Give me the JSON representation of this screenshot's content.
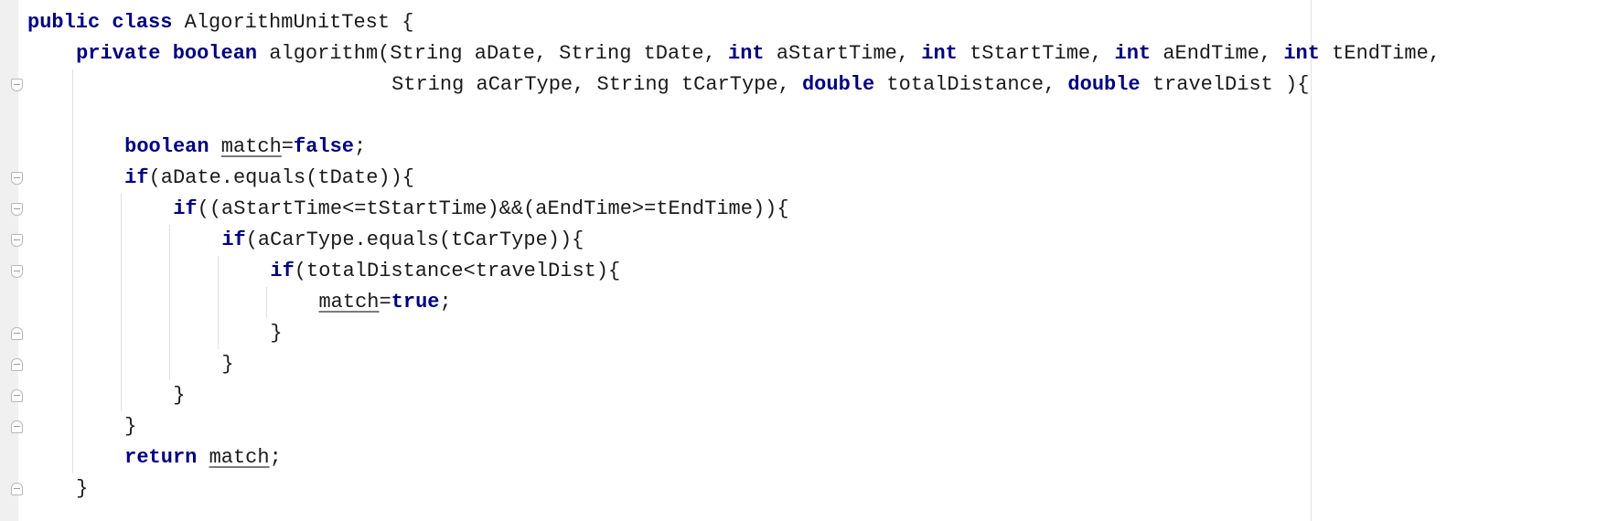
{
  "editor": {
    "language": "java",
    "colors": {
      "keyword": "#000080",
      "text": "#1a1a1a",
      "gutter": "#f0f0f0",
      "indent_guide": "#e0e0e0"
    },
    "lines": [
      {
        "indent": 0,
        "tokens": [
          {
            "text": "public",
            "kind": "kw"
          },
          {
            "text": " "
          },
          {
            "text": "class",
            "kind": "kw"
          },
          {
            "text": " AlgorithmUnitTest {"
          }
        ]
      },
      {
        "indent": 4,
        "tokens": [
          {
            "text": "private",
            "kind": "kw"
          },
          {
            "text": " "
          },
          {
            "text": "boolean",
            "kind": "kw"
          },
          {
            "text": " algorithm(String aDate, String tDate, "
          },
          {
            "text": "int",
            "kind": "kw"
          },
          {
            "text": " aStartTime, "
          },
          {
            "text": "int",
            "kind": "kw"
          },
          {
            "text": " tStartTime, "
          },
          {
            "text": "int",
            "kind": "kw"
          },
          {
            "text": " aEndTime, "
          },
          {
            "text": "int",
            "kind": "kw"
          },
          {
            "text": " tEndTime,"
          }
        ]
      },
      {
        "indent": 30,
        "tokens": [
          {
            "text": "String aCarType, String tCarType, "
          },
          {
            "text": "double",
            "kind": "kw"
          },
          {
            "text": " totalDistance, "
          },
          {
            "text": "double",
            "kind": "kw"
          },
          {
            "text": " travelDist ){"
          }
        ]
      },
      {
        "indent": 0,
        "tokens": []
      },
      {
        "indent": 8,
        "tokens": [
          {
            "text": "boolean",
            "kind": "kw"
          },
          {
            "text": " "
          },
          {
            "text": "match",
            "kind": "var"
          },
          {
            "text": "="
          },
          {
            "text": "false",
            "kind": "kw"
          },
          {
            "text": ";"
          }
        ]
      },
      {
        "indent": 8,
        "tokens": [
          {
            "text": "if",
            "kind": "kw"
          },
          {
            "text": "(aDate.equals(tDate)){"
          }
        ]
      },
      {
        "indent": 12,
        "tokens": [
          {
            "text": "if",
            "kind": "kw"
          },
          {
            "text": "((aStartTime<=tStartTime)&&(aEndTime>=tEndTime)){"
          }
        ]
      },
      {
        "indent": 16,
        "tokens": [
          {
            "text": "if",
            "kind": "kw"
          },
          {
            "text": "(aCarType.equals(tCarType)){"
          }
        ]
      },
      {
        "indent": 20,
        "tokens": [
          {
            "text": "if",
            "kind": "kw"
          },
          {
            "text": "(totalDistance<travelDist){"
          }
        ]
      },
      {
        "indent": 24,
        "tokens": [
          {
            "text": "match",
            "kind": "var"
          },
          {
            "text": "="
          },
          {
            "text": "true",
            "kind": "kw"
          },
          {
            "text": ";"
          }
        ]
      },
      {
        "indent": 20,
        "tokens": [
          {
            "text": "}"
          }
        ]
      },
      {
        "indent": 16,
        "tokens": [
          {
            "text": "}"
          }
        ]
      },
      {
        "indent": 12,
        "tokens": [
          {
            "text": "}"
          }
        ]
      },
      {
        "indent": 8,
        "tokens": [
          {
            "text": "}"
          }
        ]
      },
      {
        "indent": 8,
        "tokens": [
          {
            "text": "return",
            "kind": "kw"
          },
          {
            "text": " "
          },
          {
            "text": "match",
            "kind": "var"
          },
          {
            "text": ";"
          }
        ]
      },
      {
        "indent": 4,
        "tokens": [
          {
            "text": "}"
          }
        ]
      }
    ],
    "fold_markers": [
      {
        "line": 2,
        "type": "open"
      },
      {
        "line": 5,
        "type": "open"
      },
      {
        "line": 6,
        "type": "open"
      },
      {
        "line": 7,
        "type": "open"
      },
      {
        "line": 8,
        "type": "open"
      },
      {
        "line": 10,
        "type": "close"
      },
      {
        "line": 11,
        "type": "close"
      },
      {
        "line": 12,
        "type": "close"
      },
      {
        "line": 13,
        "type": "close"
      },
      {
        "line": 15,
        "type": "close"
      }
    ],
    "indent_guides": [
      {
        "column": 4,
        "from_line": 2,
        "to_line": 15
      },
      {
        "column": 8,
        "from_line": 6,
        "to_line": 13
      },
      {
        "column": 12,
        "from_line": 7,
        "to_line": 12
      },
      {
        "column": 16,
        "from_line": 8,
        "to_line": 11
      },
      {
        "column": 20,
        "from_line": 9,
        "to_line": 10
      }
    ]
  }
}
